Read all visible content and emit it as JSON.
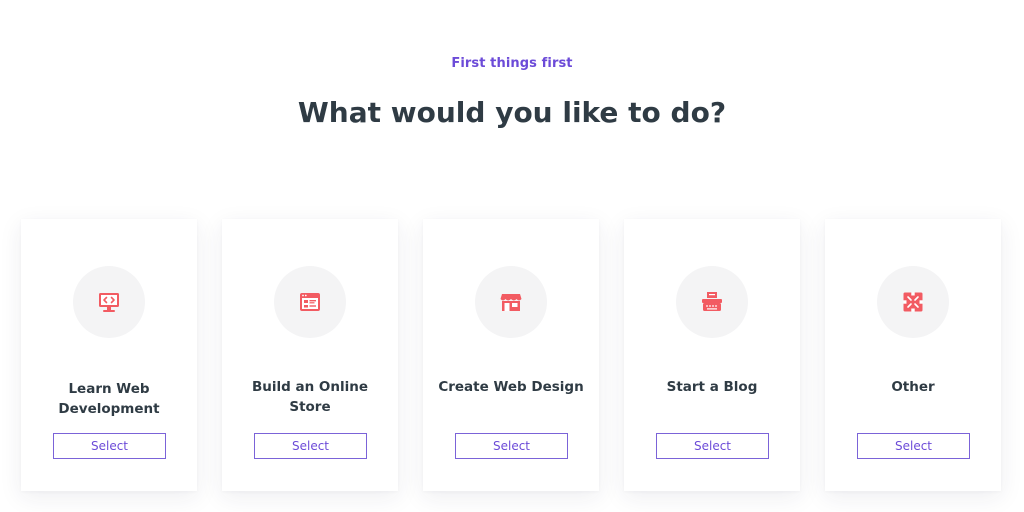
{
  "header": {
    "eyebrow": "First things first",
    "title": "What would you like to do?"
  },
  "accent_color": "#6c4bd8",
  "icon_color": "#f25b62",
  "cards": [
    {
      "icon": "code-monitor-icon",
      "label": "Learn Web Development",
      "button": "Select"
    },
    {
      "icon": "store-browser-icon",
      "label": "Build an Online Store",
      "button": "Select"
    },
    {
      "icon": "storefront-icon",
      "label": "Create Web Design",
      "button": "Select"
    },
    {
      "icon": "typewriter-icon",
      "label": "Start a Blog",
      "button": "Select"
    },
    {
      "icon": "puzzle-icon",
      "label": "Other",
      "button": "Select"
    }
  ]
}
